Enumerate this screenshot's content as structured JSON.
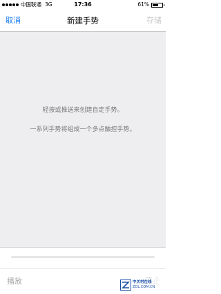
{
  "status_bar": {
    "carrier": "中国联通",
    "network": "3G",
    "time": "17:36",
    "battery_percent": "61%",
    "battery_level": 0.61
  },
  "nav": {
    "cancel_label": "取消",
    "title": "新建手势",
    "save_label": "存储"
  },
  "canvas": {
    "instruction_1": "轻按或推送来创建自定手势。",
    "instruction_2": "一系列手势将组成一个多点触控手势。"
  },
  "playback": {
    "progress": 0
  },
  "toolbar": {
    "play_label": "播放",
    "stop_label": "停止"
  },
  "watermark": {
    "name": "中关村在线",
    "url": "ZOL.COM.CN"
  },
  "colors": {
    "accent": "#1a7cf5",
    "disabled": "#c8c8c8",
    "canvas_bg": "#eeeef0",
    "hint_text": "#7a7a7a"
  }
}
